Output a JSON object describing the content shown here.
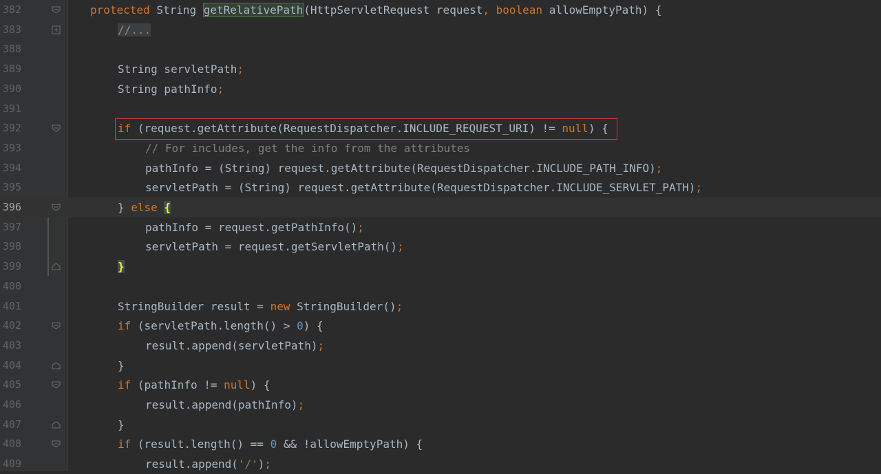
{
  "lines": [
    {
      "num": "382",
      "code": "protected String getRelativePath(HttpServletRequest request, boolean allowEmptyPath) {"
    },
    {
      "num": "383",
      "code": "//..."
    },
    {
      "num": "388",
      "code": ""
    },
    {
      "num": "389",
      "code": "String servletPath;"
    },
    {
      "num": "390",
      "code": "String pathInfo;"
    },
    {
      "num": "391",
      "code": ""
    },
    {
      "num": "392",
      "code": "if (request.getAttribute(RequestDispatcher.INCLUDE_REQUEST_URI) != null) {"
    },
    {
      "num": "393",
      "code": "// For includes, get the info from the attributes"
    },
    {
      "num": "394",
      "code": "pathInfo = (String) request.getAttribute(RequestDispatcher.INCLUDE_PATH_INFO);"
    },
    {
      "num": "395",
      "code": "servletPath = (String) request.getAttribute(RequestDispatcher.INCLUDE_SERVLET_PATH);"
    },
    {
      "num": "396",
      "code": "} else {"
    },
    {
      "num": "397",
      "code": "pathInfo = request.getPathInfo();"
    },
    {
      "num": "398",
      "code": "servletPath = request.getServletPath();"
    },
    {
      "num": "399",
      "code": "}"
    },
    {
      "num": "400",
      "code": ""
    },
    {
      "num": "401",
      "code": "StringBuilder result = new StringBuilder();"
    },
    {
      "num": "402",
      "code": "if (servletPath.length() > 0) {"
    },
    {
      "num": "403",
      "code": "result.append(servletPath);"
    },
    {
      "num": "404",
      "code": "}"
    },
    {
      "num": "405",
      "code": "if (pathInfo != null) {"
    },
    {
      "num": "406",
      "code": "result.append(pathInfo);"
    },
    {
      "num": "407",
      "code": "}"
    },
    {
      "num": "408",
      "code": "if (result.length() == 0 && !allowEmptyPath) {"
    },
    {
      "num": "409",
      "code": "result.append('/');"
    }
  ],
  "current_line": "396",
  "colors": {
    "background": "#2b2b2b",
    "keyword": "#cc7832",
    "comment": "#808080",
    "number": "#6897bb",
    "string": "#6a8759",
    "text": "#a9b7c6",
    "highlight_box": "#d93a3a"
  },
  "icons": [
    "fold-open-icon",
    "fold-close-icon",
    "fold-collapsed-icon"
  ]
}
